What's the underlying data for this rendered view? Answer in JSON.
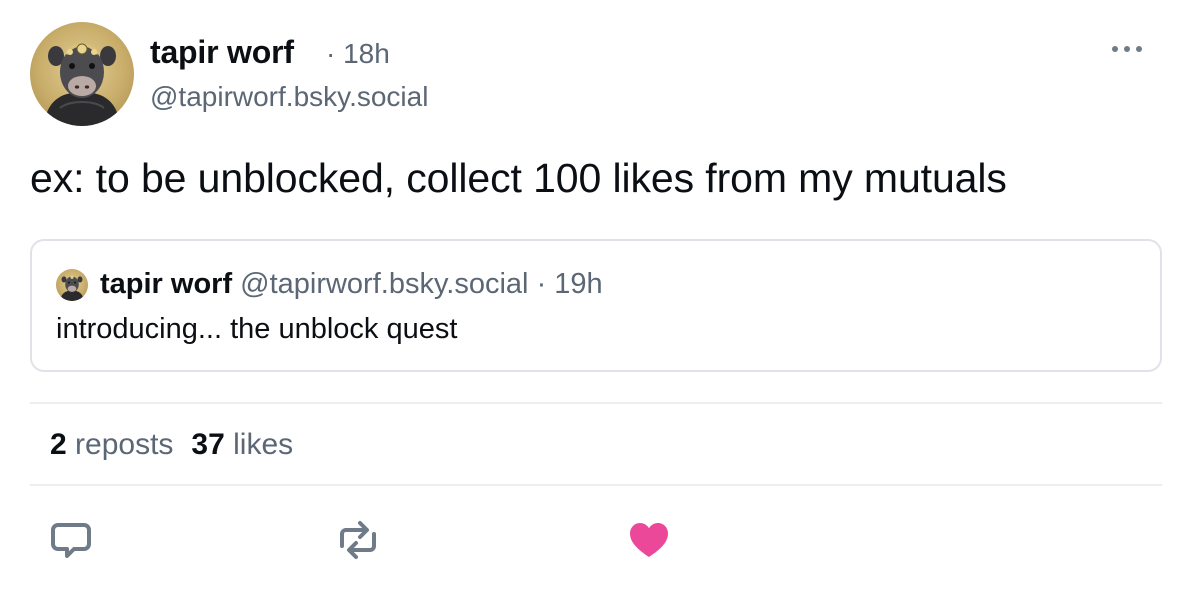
{
  "post": {
    "author_name": "tapir worf",
    "separator": "·",
    "time": "18h",
    "handle": "@tapirworf.bsky.social",
    "text": "ex: to be unblocked, collect 100 likes from my mutuals"
  },
  "quote": {
    "author_name": "tapir worf",
    "handle": "@tapirworf.bsky.social",
    "separator": "·",
    "time": "19h",
    "text": "introducing... the unblock quest"
  },
  "stats": {
    "reposts_count": "2",
    "reposts_label": "reposts",
    "likes_count": "37",
    "likes_label": "likes"
  },
  "icons": {
    "more": "ellipsis-icon",
    "reply": "speech-bubble-icon",
    "repost": "repost-arrows-icon",
    "like": "heart-icon"
  },
  "colors": {
    "text": "#0b0f14",
    "muted": "#5b6775",
    "border": "#dfe3e8",
    "like_active": "#ec4899",
    "icon": "#6f7b88"
  }
}
